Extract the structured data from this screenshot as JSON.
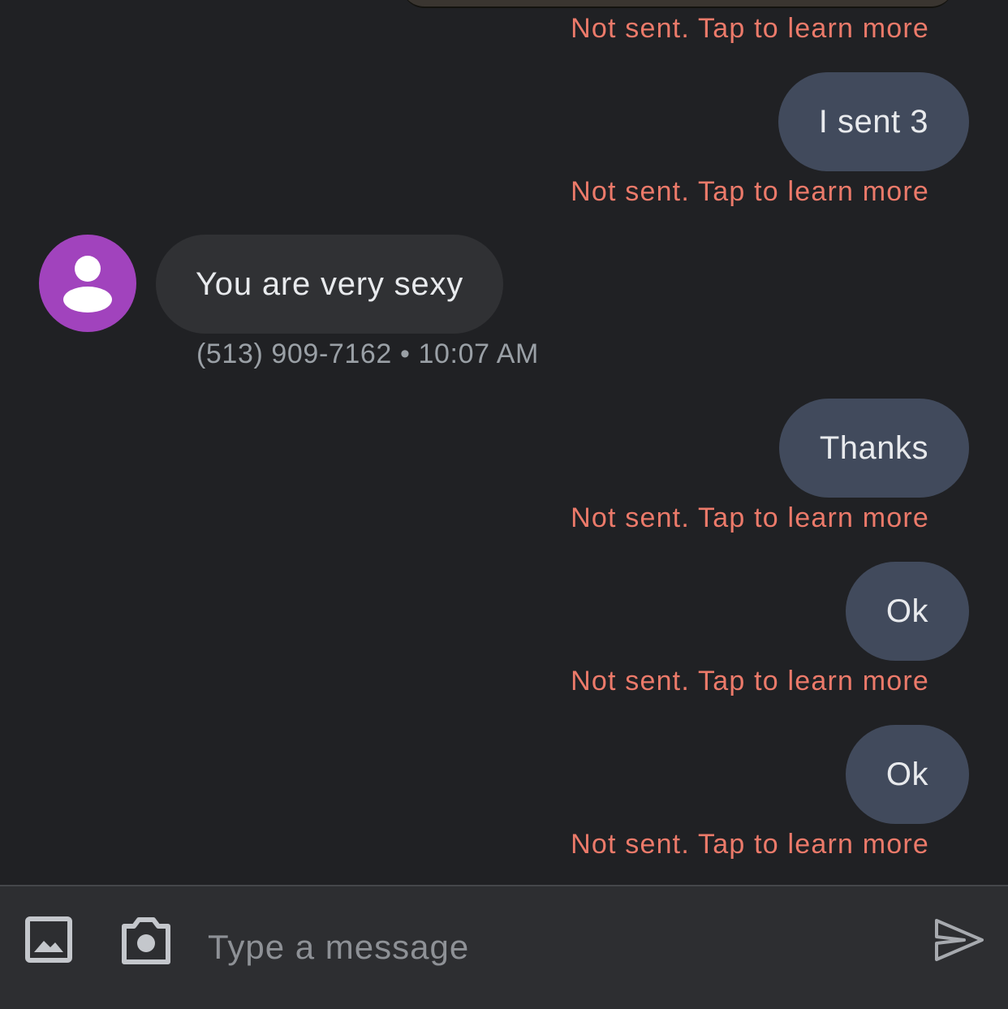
{
  "thread": {
    "messages": [
      {
        "direction": "outgoing",
        "type": "image",
        "status": "Not sent. Tap to learn more"
      },
      {
        "direction": "outgoing",
        "text": "I sent 3",
        "status": "Not sent. Tap to learn more"
      },
      {
        "direction": "incoming",
        "text": "You are very sexy",
        "sender": "(513) 909-7162",
        "separator": "•",
        "time": "10:07 AM"
      },
      {
        "direction": "outgoing",
        "text": "Thanks",
        "status": "Not sent. Tap to learn more"
      },
      {
        "direction": "outgoing",
        "text": "Ok",
        "status": "Not sent. Tap to learn more"
      },
      {
        "direction": "outgoing",
        "text": "Ok",
        "status": "Not sent. Tap to learn more"
      }
    ]
  },
  "composer": {
    "placeholder": "Type a message",
    "icons": [
      "image-gallery-icon",
      "camera-icon",
      "send-icon"
    ]
  },
  "colors": {
    "background": "#202124",
    "outgoing_bubble": "#414a5c",
    "incoming_bubble": "#303134",
    "error_text": "#ec7a6a",
    "avatar": "#a143bd",
    "composer_background": "#2d2e31"
  }
}
